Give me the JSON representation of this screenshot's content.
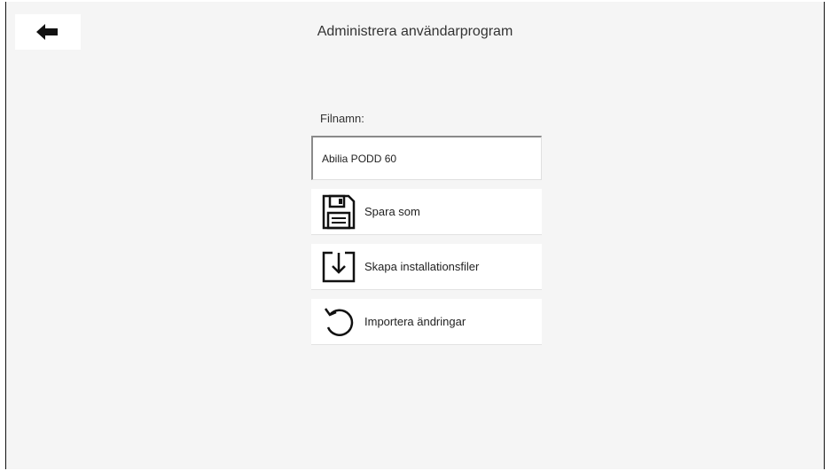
{
  "header": {
    "title": "Administrera användarprogram",
    "back_icon": "arrow-left-icon"
  },
  "form": {
    "filename_label": "Filnamn:",
    "filename_value": "Abilia PODD 60"
  },
  "actions": [
    {
      "label": "Spara som",
      "icon": "floppy-disk-icon"
    },
    {
      "label": "Skapa installationsfiler",
      "icon": "download-tray-icon"
    },
    {
      "label": "Importera ändringar",
      "icon": "undo-circular-arrow-icon"
    }
  ],
  "colors": {
    "background": "#f5f5f5",
    "card": "#ffffff",
    "text": "#222222"
  }
}
